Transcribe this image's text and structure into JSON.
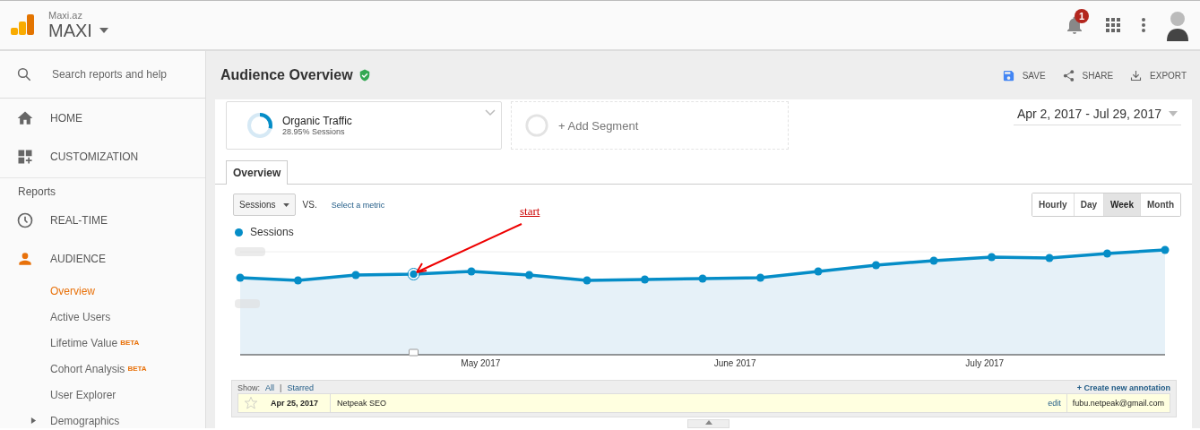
{
  "header": {
    "account": "Maxi.az",
    "property": "MAXI",
    "notifications": "1"
  },
  "sidebar": {
    "search": {
      "placeholder": "Search reports and help"
    },
    "top_items": [
      {
        "label": "HOME",
        "kind": "home"
      },
      {
        "label": "CUSTOMIZATION",
        "kind": "dashboard"
      }
    ],
    "section": "Reports",
    "items": [
      {
        "label": "REAL-TIME",
        "kind": "clock",
        "selected": false
      },
      {
        "label": "AUDIENCE",
        "kind": "person",
        "selected": true,
        "children": [
          {
            "label": "Overview",
            "selected": true
          },
          {
            "label": "Active Users",
            "selected": false
          },
          {
            "label": "Lifetime Value",
            "badge": "BETA",
            "selected": false
          },
          {
            "label": "Cohort Analysis",
            "badge": "BETA",
            "selected": false
          },
          {
            "label": "User Explorer",
            "selected": false
          },
          {
            "label": "Demographics",
            "selected": false,
            "expanded": false
          }
        ]
      }
    ]
  },
  "page": {
    "title": "Audience Overview",
    "verified": true,
    "actions": [
      {
        "label": "SAVE",
        "kind": "save"
      },
      {
        "label": "SHARE",
        "kind": "share"
      },
      {
        "label": "EXPORT",
        "kind": "export"
      }
    ],
    "segments": [
      {
        "name": "Organic Traffic",
        "detail": "28.95% Sessions"
      }
    ],
    "add_segment": "+ Add Segment",
    "date_range": "Apr 2, 2017 - Jul 29, 2017",
    "tabs": [
      {
        "label": "Overview",
        "selected": true
      }
    ],
    "metric": "Sessions",
    "vs": "VS.",
    "compare_link": "Select a metric",
    "granularity": [
      {
        "label": "Hourly",
        "selected": false
      },
      {
        "label": "Day",
        "selected": false
      },
      {
        "label": "Week",
        "selected": true
      },
      {
        "label": "Month",
        "selected": false
      }
    ],
    "legend": {
      "label": "Sessions",
      "color": "#058dc7"
    },
    "x_labels": [
      "May 2017",
      "June 2017",
      "July 2017"
    ],
    "note": "start",
    "annotations": {
      "show": "Show:",
      "filters": [
        "All",
        "Starred"
      ],
      "separator": "|",
      "create": "+ Create new annotation",
      "rows": [
        {
          "starred": false,
          "date": "Apr 25, 2017",
          "text": "Netpeak SEO",
          "edit": "edit",
          "author": "fubu.netpeak@gmail.com"
        }
      ]
    }
  }
}
